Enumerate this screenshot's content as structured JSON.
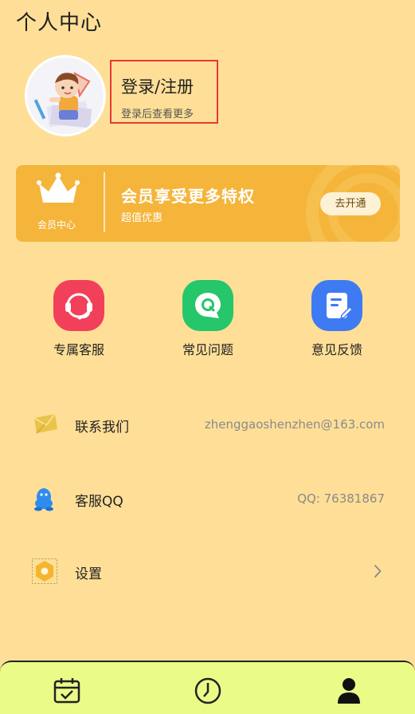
{
  "header": {
    "title": "个人中心"
  },
  "profile": {
    "login_label": "登录/注册",
    "login_hint": "登录后查看更多"
  },
  "vip": {
    "center_label": "会员中心",
    "title": "会员享受更多特权",
    "subtitle": "超值优惠",
    "button": "去开通"
  },
  "quick_actions": [
    {
      "label": "专属客服",
      "icon": "headset-icon",
      "color": "#F3405A"
    },
    {
      "label": "常见问题",
      "icon": "question-chat-icon",
      "color": "#26C66A"
    },
    {
      "label": "意见反馈",
      "icon": "feedback-doc-icon",
      "color": "#3E7BF2"
    }
  ],
  "menu": [
    {
      "label": "联系我们",
      "value": "zhenggaoshenzhen@163.com",
      "icon": "envelope-icon"
    },
    {
      "label": "客服QQ",
      "value": "QQ: 76381867",
      "icon": "qq-penguin-icon"
    },
    {
      "label": "设置",
      "value": "",
      "icon": "settings-hexagon-icon"
    }
  ],
  "tabbar": [
    {
      "icon": "calendar-check-icon"
    },
    {
      "icon": "clock-icon"
    },
    {
      "icon": "user-icon",
      "active": true
    }
  ]
}
